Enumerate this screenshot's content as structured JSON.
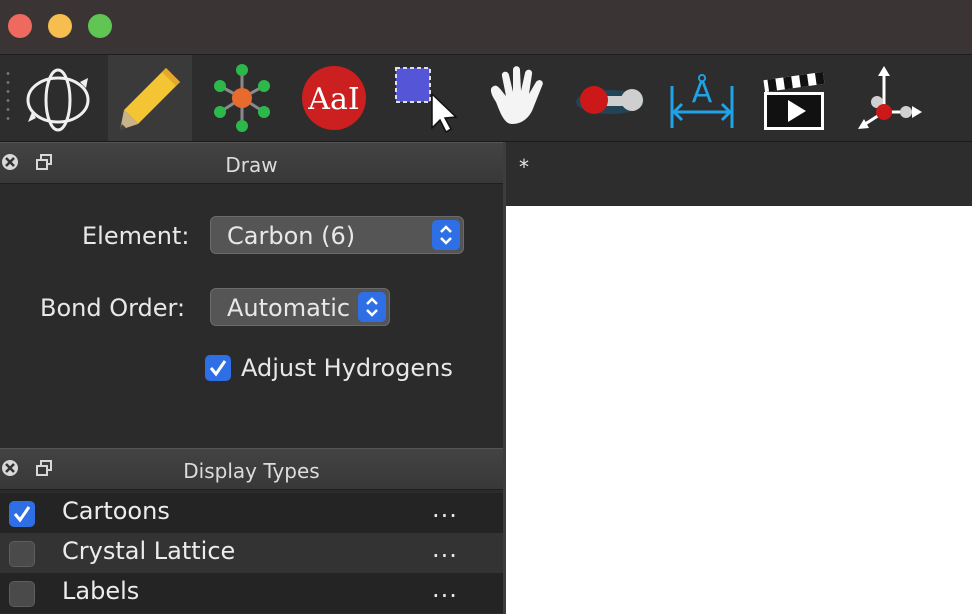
{
  "window": {
    "close_color": "#ee6a5f",
    "minimize_color": "#f5be4f",
    "maximize_color": "#61c554"
  },
  "toolbar": {
    "tools": [
      {
        "name": "navigate-tool",
        "icon": "rotate-orbit-icon"
      },
      {
        "name": "draw-tool",
        "icon": "pencil-icon",
        "active": true
      },
      {
        "name": "template-tool",
        "icon": "molecule-template-icon"
      },
      {
        "name": "label-tool",
        "icon": "text-label-icon",
        "text": "AaI"
      },
      {
        "name": "select-tool",
        "icon": "selection-cursor-icon"
      },
      {
        "name": "manipulate-tool",
        "icon": "hand-icon"
      },
      {
        "name": "bond-centric-tool",
        "icon": "bond-icon"
      },
      {
        "name": "measure-tool",
        "icon": "angstrom-ruler-icon",
        "text": "Å"
      },
      {
        "name": "animation-tool",
        "icon": "clapperboard-play-icon"
      },
      {
        "name": "align-tool",
        "icon": "axes-align-icon"
      }
    ]
  },
  "draw_panel": {
    "title": "Draw",
    "element_label": "Element:",
    "element_value": "Carbon (6)",
    "bond_order_label": "Bond Order:",
    "bond_order_value": "Automatic",
    "adjust_hydrogens_label": "Adjust Hydrogens",
    "adjust_hydrogens_checked": true
  },
  "display_types": {
    "title": "Display Types",
    "items": [
      {
        "label": "Cartoons",
        "checked": true,
        "more": "..."
      },
      {
        "label": "Crystal Lattice",
        "checked": false,
        "more": "..."
      },
      {
        "label": "Labels",
        "checked": false,
        "more": "..."
      }
    ]
  },
  "document": {
    "tab_label": "*"
  },
  "colors": {
    "accent": "#2f6fe6",
    "viewport": "#ffffff"
  }
}
